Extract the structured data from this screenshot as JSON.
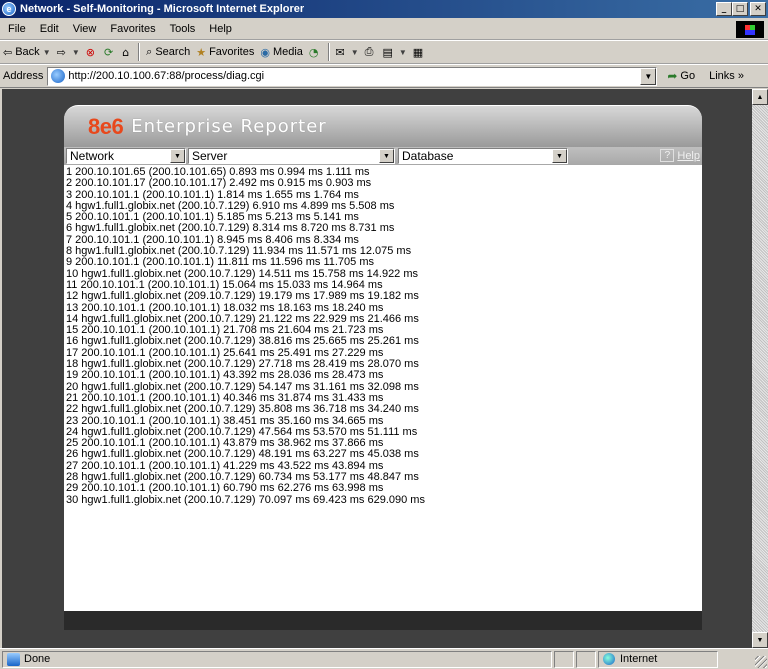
{
  "window": {
    "title": "Network - Self-Monitoring - Microsoft Internet Explorer",
    "minimize": "_",
    "maximize": "□",
    "close": "✕"
  },
  "menu": [
    "File",
    "Edit",
    "View",
    "Favorites",
    "Tools",
    "Help"
  ],
  "toolbar": {
    "back": "Back",
    "search": "Search",
    "favorites": "Favorites",
    "media": "Media"
  },
  "address": {
    "label": "Address",
    "url": "http://200.10.100.67:88/process/diag.cgi",
    "go": "Go",
    "links": "Links"
  },
  "header": {
    "logo_prefix": "8e6",
    "logo_text": "Enterprise Reporter"
  },
  "selects": {
    "network": "Network",
    "server": "Server",
    "database": "Database"
  },
  "help": {
    "icon": "?",
    "label": "Help"
  },
  "results": [
    "1 200.10.101.65 (200.10.101.65) 0.893 ms 0.994 ms 1.111 ms",
    "2 200.10.101.17 (200.10.101.17) 2.492 ms 0.915 ms 0.903 ms",
    "3 200.10.101.1 (200.10.101.1) 1.814 ms 1.655 ms 1.764 ms",
    "4 hgw1.full1.globix.net (200.10.7.129) 6.910 ms 4.899 ms 5.508 ms",
    "5 200.10.101.1 (200.10.101.1) 5.185 ms 5.213 ms 5.141 ms",
    "6 hgw1.full1.globix.net (200.10.7.129) 8.314 ms 8.720 ms 8.731 ms",
    "7 200.10.101.1 (200.10.101.1) 8.945 ms 8.406 ms 8.334 ms",
    "8 hgw1.full1.globix.net (200.10.7.129) 11.934 ms 11.571 ms 12.075 ms",
    "9 200.10.101.1 (200.10.101.1) 11.811 ms 11.596 ms 11.705 ms",
    "10 hgw1.full1.globix.net (200.10.7.129) 14.511 ms 15.758 ms 14.922 ms",
    "11 200.10.101.1 (200.10.101.1) 15.064 ms 15.033 ms 14.964 ms",
    "12 hgw1.full1.globix.net (209.10.7.129) 19.179 ms 17.989 ms 19.182 ms",
    "13 200.10.101.1 (200.10.101.1) 18.032 ms 18.163 ms 18.240 ms",
    "14 hgw1.full1.globix.net (200.10.7.129) 21.122 ms 22.929 ms 21.466 ms",
    "15 200.10.101.1 (200.10.101.1) 21.708 ms 21.604 ms 21.723 ms",
    "16 hgw1.full1.globix.net (200.10.7.129) 38.816 ms 25.665 ms 25.261 ms",
    "17 200.10.101.1 (200.10.101.1) 25.641 ms 25.491 ms 27.229 ms",
    "18 hgw1.full1.globix.net (200.10.7.129) 27.718 ms 28.419 ms 28.070 ms",
    "19 200.10.101.1 (200.10.101.1) 43.392 ms 28.036 ms 28.473 ms",
    "20 hgw1.full1.globix.net (200.10.7.129) 54.147 ms 31.161 ms 32.098 ms",
    "21 200.10.101.1 (200.10.101.1) 40.346 ms 31.874 ms 31.433 ms",
    "22 hgw1.full1.globix.net (200.10.7.129) 35.808 ms 36.718 ms 34.240 ms",
    "23 200.10.101.1 (200.10.101.1) 38.451 ms 35.160 ms 34.665 ms",
    "24 hgw1.full1.globix.net (200.10.7.129) 47.564 ms 53.570 ms 51.111 ms",
    "25 200.10.101.1 (200.10.101.1) 43.879 ms 38.962 ms 37.866 ms",
    "26 hgw1.full1.globix.net (200.10.7.129) 48.191 ms 63.227 ms 45.038 ms",
    "27 200.10.101.1 (200.10.101.1) 41.229 ms 43.522 ms 43.894 ms",
    "28 hgw1.full1.globix.net (200.10.7.129) 60.734 ms 53.177 ms 48.847 ms",
    "29 200.10.101.1 (200.10.101.1) 60.790 ms 62.276 ms 63.998 ms",
    "30 hgw1.full1.globix.net (200.10.7.129) 70.097 ms 69.423 ms 629.090 ms"
  ],
  "status": {
    "text": "Done",
    "zone": "Internet"
  }
}
